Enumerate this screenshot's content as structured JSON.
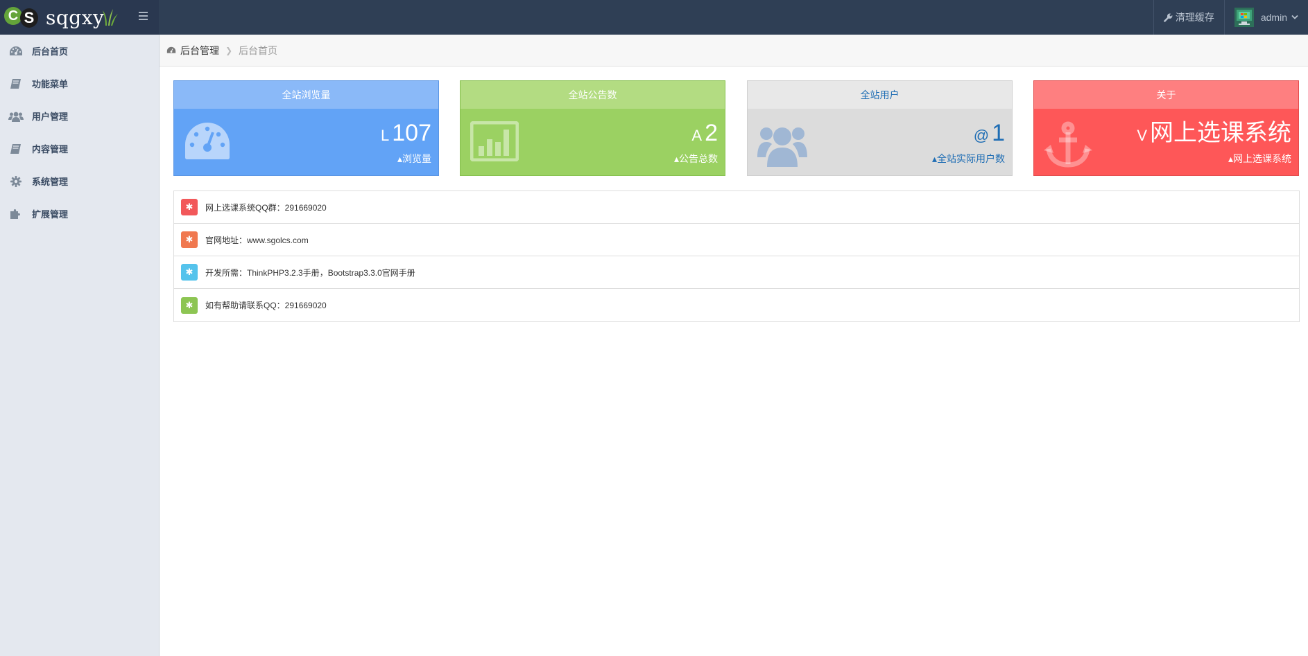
{
  "brand": {
    "logo_c": "C",
    "logo_s": "S",
    "name": "sqgxy"
  },
  "navbar": {
    "clear_cache_label": "清理缓存",
    "user_name": "admin"
  },
  "sidebar": {
    "items": [
      {
        "label": "后台首页",
        "icon": "dashboard-icon"
      },
      {
        "label": "功能菜单",
        "icon": "book-icon"
      },
      {
        "label": "用户管理",
        "icon": "users-icon"
      },
      {
        "label": "内容管理",
        "icon": "book-icon"
      },
      {
        "label": "系统管理",
        "icon": "gear-icon"
      },
      {
        "label": "扩展管理",
        "icon": "puzzle-icon"
      }
    ]
  },
  "breadcrumb": {
    "root": "后台管理",
    "current": "后台首页"
  },
  "stats": [
    {
      "title": "全站浏览量",
      "prefix": "L",
      "value": "107",
      "subtitle": "浏览量",
      "icon": "dashboard-icon",
      "color": "#62a3f6"
    },
    {
      "title": "全站公告数",
      "prefix": "A",
      "value": "2",
      "subtitle": "公告总数",
      "icon": "bar-chart-icon",
      "color": "#9bd162"
    },
    {
      "title": "全站用户",
      "prefix": "@",
      "value": "1",
      "subtitle": "全站实际用户数",
      "icon": "users-icon",
      "color": "#dcdcdc"
    },
    {
      "title": "关于",
      "prefix": "V",
      "value": "网上选课系统",
      "subtitle": "网上选课系统",
      "icon": "anchor-icon",
      "color": "#fe5758"
    }
  ],
  "info": [
    {
      "text": "网上选课系统QQ群：291669020",
      "badge_color": "#f2585a"
    },
    {
      "text": "官网地址：www.sgolcs.com",
      "badge_color": "#f0784f"
    },
    {
      "text": "开发所需：ThinkPHP3.2.3手册，Bootstrap3.3.0官网手册",
      "badge_color": "#55c3ec"
    },
    {
      "text": "如有帮助请联系QQ：291669020",
      "badge_color": "#8dc553"
    }
  ]
}
